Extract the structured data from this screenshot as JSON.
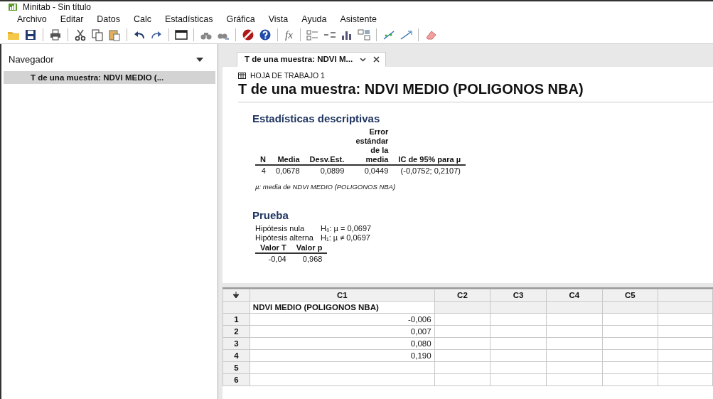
{
  "window": {
    "title": "Minitab - Sin título"
  },
  "menu": [
    "Archivo",
    "Editar",
    "Datos",
    "Calc",
    "Estadísticas",
    "Gráfica",
    "Vista",
    "Ayuda",
    "Asistente"
  ],
  "toolbar": {
    "formula_label": "fx"
  },
  "navigator": {
    "title": "Navegador",
    "items": [
      {
        "label": "T de una muestra: NDVI MEDIO (...",
        "selected": true
      }
    ]
  },
  "tabs": [
    {
      "label": "T de una muestra: NDVI M...",
      "selected": true
    }
  ],
  "output": {
    "worksheet": "HOJA DE TRABAJO 1",
    "title": "T de una muestra: NDVI MEDIO (POLIGONOS NBA)",
    "descriptive": {
      "heading": "Estadísticas descriptivas",
      "columns": [
        "N",
        "Media",
        "Desv.Est.",
        "Error estándar de la media",
        "IC de 95% para µ"
      ],
      "rows": [
        [
          "4",
          "0,0678",
          "0,0899",
          "0,0449",
          "(-0,0752; 0,2107)"
        ]
      ],
      "note": "µ: media de NDVI MEDIO (POLIGONOS NBA)"
    },
    "test": {
      "heading": "Prueba",
      "hypotheses": [
        {
          "label": "Hipótesis nula",
          "value": "H₀: µ = 0,0697"
        },
        {
          "label": "Hipótesis alterna",
          "value": "H₁: µ ≠ 0,0697"
        }
      ],
      "columns": [
        "Valor T",
        "Valor p"
      ],
      "rows": [
        [
          "-0,04",
          "0,968"
        ]
      ]
    }
  },
  "worksheet": {
    "columns": [
      {
        "header": "C1",
        "name": "NDVI MEDIO (POLIGONOS NBA)"
      },
      {
        "header": "C2"
      },
      {
        "header": "C3"
      },
      {
        "header": "C4"
      },
      {
        "header": "C5"
      }
    ],
    "rows": [
      {
        "number": "1",
        "values": [
          "-0,006"
        ]
      },
      {
        "number": "2",
        "values": [
          "0,007"
        ]
      },
      {
        "number": "3",
        "values": [
          "0,080"
        ]
      },
      {
        "number": "4",
        "values": [
          "0,190"
        ]
      },
      {
        "number": "5"
      },
      {
        "number": "6"
      }
    ]
  }
}
